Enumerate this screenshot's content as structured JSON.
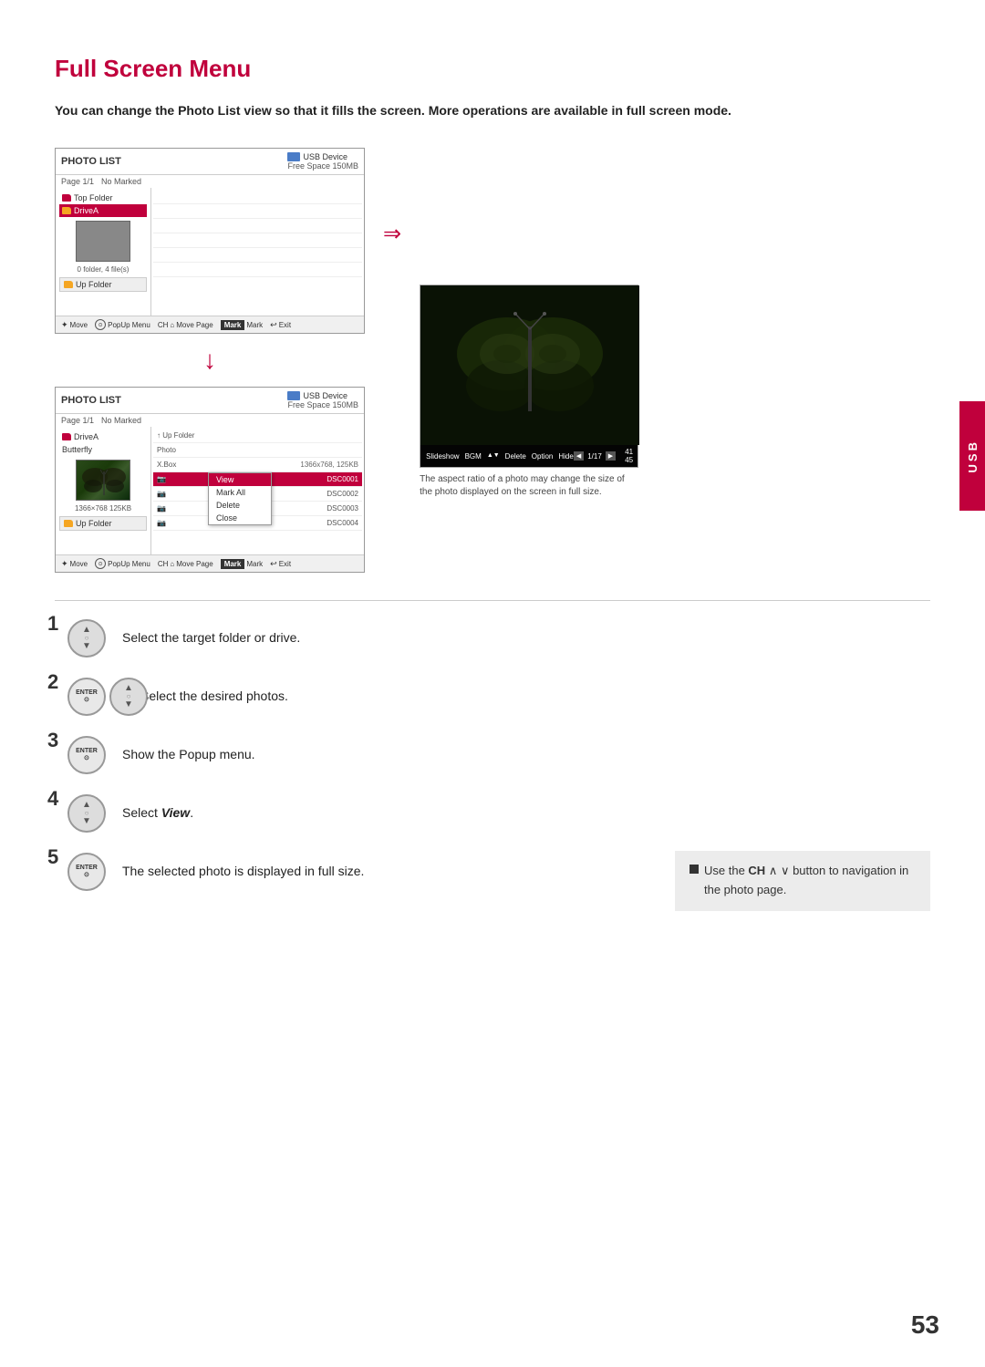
{
  "page": {
    "title": "Full Screen Menu",
    "page_number": "53",
    "intro_text": "You can change the Photo List view so that it fills the screen. More operations are available in full screen mode."
  },
  "sidebar": {
    "tab_label": "USB"
  },
  "diagram_top": {
    "photo_list_title": "PHOTO LIST",
    "page_info": "Page 1/1",
    "marked": "No Marked",
    "usb_label": "USB Device",
    "free_space": "Free Space 150MB",
    "top_folder": "Top Folder",
    "drive_a": "DriveA",
    "file_count": "0 folder, 4 file(s)",
    "up_folder": "Up Folder"
  },
  "diagram_middle": {
    "photo_list_title": "PHOTO LIST",
    "page_info": "Page 1/1",
    "marked": "No Marked",
    "usb_label": "USB Device",
    "free_space": "Free Space 150MB",
    "drive_a": "DriveA",
    "butterfly": "Butterfly",
    "dimensions": "1366×768 125KB",
    "up_folder": "Up Folder",
    "file_up_folder": "Up Folder",
    "file_photo": "Photo",
    "file_xbox": "X.Box",
    "file_dims": "1366x768, 125KB",
    "file_dsc0001": "DSC0001",
    "file_dsc0002": "DSC0002",
    "file_dsc0003": "DSC0003",
    "file_dsc0004": "DSC0004",
    "popup": {
      "view": "View",
      "mark_all": "Mark All",
      "delete": "Delete",
      "close": "Close"
    }
  },
  "full_photo": {
    "caption": "The aspect ratio of a photo may change the size of the photo displayed on the screen in full size.",
    "counter": "1/17",
    "volume": "41 45",
    "controls": [
      "Slideshow",
      "BGM",
      "Delete",
      "Option",
      "Hide"
    ]
  },
  "steps": [
    {
      "number": "1",
      "text": "Select the target folder or drive.",
      "buttons": [
        "nav"
      ]
    },
    {
      "number": "2",
      "text": "Select the desired photos.",
      "buttons": [
        "enter",
        "nav"
      ]
    },
    {
      "number": "3",
      "text": "Show the Popup menu.",
      "buttons": [
        "enter"
      ]
    },
    {
      "number": "4",
      "text": "Select View.",
      "buttons": [
        "nav"
      ]
    },
    {
      "number": "5",
      "text": "The selected photo is displayed in full size.",
      "buttons": [
        "enter"
      ]
    }
  ],
  "note": {
    "text": "Use the CH ∧ ∨ button to navigation in the photo page."
  },
  "controls_bar": {
    "move": "Move",
    "popup_menu": "PopUp Menu",
    "ch": "CH",
    "move_page": "Move Page",
    "mark": "Mark",
    "exit": "Exit"
  }
}
